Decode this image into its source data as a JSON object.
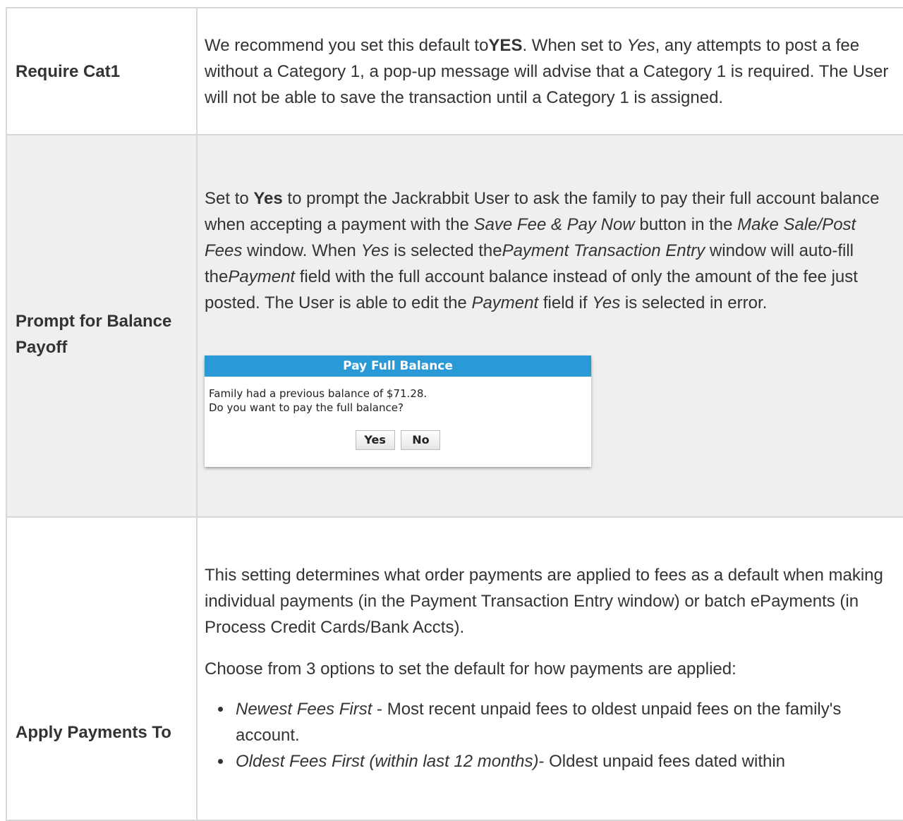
{
  "rows": [
    {
      "label": "Require Cat1",
      "desc": {
        "t1": "We recommend you set this default to",
        "b1": "YES",
        "t2": ". When set to ",
        "i1": "Yes",
        "t3": ", any attempts to post a fee without a Category 1, a pop-up message will advise that a Category 1 is required. The User will not be able to save the transaction until a Category 1 is assigned."
      }
    },
    {
      "label": "Prompt for Balance Payoff",
      "desc": {
        "t1": "Set to ",
        "b1": "Yes",
        "t2": " to prompt the Jackrabbit User to ask the family to pay their full account balance when accepting a payment with the ",
        "i1": "Save Fee & Pay Now",
        "t3": " button in the ",
        "i2": "Make Sale/Post Fees",
        "t4": " window. When ",
        "i3": "Yes",
        "t5": " is selected the",
        "i4": "Payment Transaction Entry",
        "t6": " window will auto-fill the",
        "i5": "Payment",
        "t7": " field with the full account balance instead of only the amount of the fee just posted. The User is able to edit the ",
        "i6": "Payment",
        "t8": " field if ",
        "i7": "Yes",
        "t9": " is selected in error."
      },
      "dialog": {
        "title": "Pay Full Balance",
        "line1": "Family had a previous balance of $71.28.",
        "line2": "Do you want to pay the full balance?",
        "yes_label": "Yes",
        "no_label": "No"
      }
    },
    {
      "label": "Apply Payments To",
      "p1": "This setting determines what order payments are applied to fees as a default when making individual payments (in the Payment Transaction Entry window) or batch ePayments (in Process Credit Cards/Bank Accts).",
      "p2": "Choose from 3 options to set the default for how payments are applied:",
      "options": [
        {
          "name": "Newest Fees First",
          "text": " - Most recent unpaid fees to oldest unpaid fees on the family's account."
        },
        {
          "name": "Oldest Fees First (within last 12 months)",
          "text": "- Oldest unpaid fees dated within"
        }
      ]
    }
  ]
}
